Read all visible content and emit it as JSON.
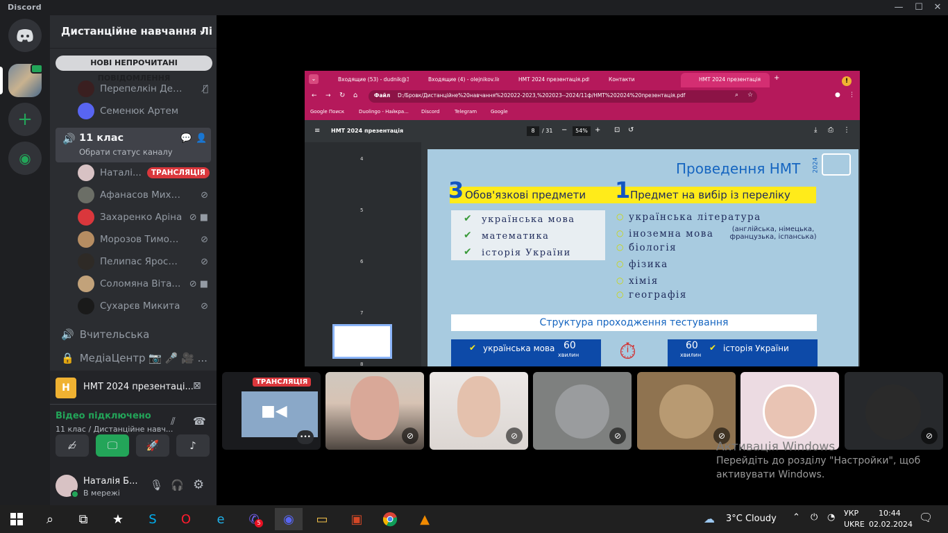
{
  "app": {
    "name": "Discord"
  },
  "window_controls": {
    "minimize": "—",
    "maximize": "☐",
    "close": "✕"
  },
  "server": {
    "name": "Дистанційне навчання Лі",
    "chevron": "⌄"
  },
  "unread_pill": "НОВІ НЕПРОЧИТАНІ ПОВІДОМЛЕННЯ",
  "members_top": [
    {
      "name": "Перепелкін Денис",
      "avatar_color": "#3a1f20"
    },
    {
      "name": "Семенюк Артем",
      "avatar_color": "#5865f2"
    }
  ],
  "voice_channel": {
    "name": "11 клас",
    "status_hint": "Обрати статус каналу"
  },
  "voice_members": [
    {
      "name": "Наталі...",
      "live": "ТРАНСЛЯЦІЯ",
      "avatar_color": "#d8c2c4"
    },
    {
      "name": "Афанасов Михайло",
      "avatar_color": "#6b6e66"
    },
    {
      "name": "Захаренко Аріна",
      "avatar_color": "#da373c",
      "camera": true
    },
    {
      "name": "Морозов Тимофій",
      "avatar_color": "#b68d62"
    },
    {
      "name": "Пелипас Ярослав",
      "avatar_color": "#2e2a26"
    },
    {
      "name": "Соломяна Віта...",
      "avatar_color": "#c2a27a",
      "camera": true
    },
    {
      "name": "Сухарєв Микита",
      "avatar_color": "#1a1a1a"
    }
  ],
  "channels_after": [
    {
      "name": "Вчительська",
      "icon": "speaker-icon"
    },
    {
      "name": "МедіаЦентр 📷 🎤 🎥 ...",
      "icon": "lock-icon"
    }
  ],
  "stream_panel": {
    "title": "НМТ 2024 презентаці...",
    "badge": "H"
  },
  "voice_status": {
    "connected": "Відео підключено",
    "location": "11 клас / Дистанційне навч..."
  },
  "user": {
    "name": "Наталія Б...",
    "status": "В мережі"
  },
  "browser": {
    "tabs": [
      "Входящие (53) - dudnik@3...",
      "Входящие (4) - olejnikov.lin...",
      "НМТ 2024 презентація.pdf",
      "Контакти",
      "НМТ 2024 презентація"
    ],
    "address_label": "Файл",
    "url": "D:/Бровк/Дистанційне%20навчання%202022-2023,%202023--2024/11ф/НМТ%202024%20презентація.pdf",
    "bookmarks": [
      "Google Поиск",
      "Duolingo - Найкра...",
      "Discord",
      "Telegram",
      "Google"
    ]
  },
  "pdf": {
    "title": "НМТ 2024 презентація",
    "page": "8",
    "pages_total": "/ 31",
    "zoom": "54%",
    "thumb_pages": [
      "4",
      "5",
      "6",
      "7",
      "8"
    ]
  },
  "slide": {
    "heading": "Проведення НМТ",
    "year": "2024",
    "num_required": "3",
    "required_label": "Обов'язкові предмети",
    "num_choice": "1",
    "choice_label": "Предмет на вибір із переліку",
    "required_subjects": [
      "українська мова",
      "математика",
      "історія України"
    ],
    "choice_subjects": [
      "українська література",
      "іноземна мова",
      "біологія",
      "фізика",
      "хімія",
      "географія"
    ],
    "languages_note": "(англійська, німецька, французька, іспанська)",
    "structure_title": "Структура проходження тестування",
    "block_left_subject": "українська мова",
    "block_right_subject": "історія України",
    "minutes": "60",
    "minutes_label": "хвилин"
  },
  "stream_tile": {
    "live": "ТРАНСЛЯЦІЯ",
    "more": "•••"
  },
  "activation": {
    "title": "Активація Windows",
    "line1": "Перейдіть до розділу \"Настройки\", щоб",
    "line2": "активувати Windows."
  },
  "taskbar": {
    "weather": "3°C  Cloudy",
    "lang_top": "УКР",
    "lang_bottom": "UKRE",
    "time": "10:44",
    "date": "02.02.2024",
    "viber_badge": "5"
  }
}
